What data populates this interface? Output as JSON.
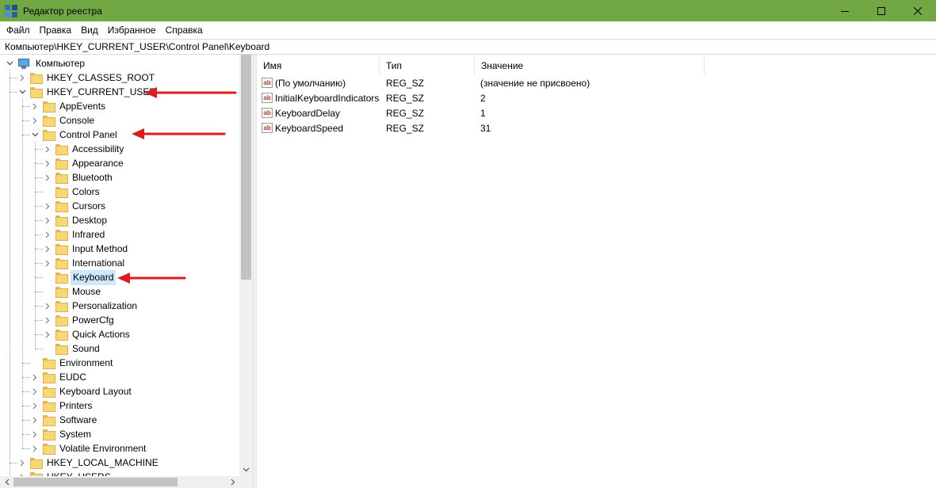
{
  "window": {
    "title": "Редактор реестра",
    "controls": {
      "minimize": "minimize-icon",
      "maximize": "maximize-icon",
      "close": "close-icon"
    }
  },
  "menu": [
    {
      "id": "file",
      "label": "Файл"
    },
    {
      "id": "edit",
      "label": "Правка"
    },
    {
      "id": "view",
      "label": "Вид"
    },
    {
      "id": "favorites",
      "label": "Избранное"
    },
    {
      "id": "help",
      "label": "Справка"
    }
  ],
  "address": "Компьютер\\HKEY_CURRENT_USER\\Control Panel\\Keyboard",
  "tree": [
    {
      "label": "Компьютер",
      "depth": 0,
      "expander": "down",
      "icon": "computer"
    },
    {
      "label": "HKEY_CLASSES_ROOT",
      "depth": 1,
      "expander": "right"
    },
    {
      "label": "HKEY_CURRENT_USER",
      "depth": 1,
      "expander": "down"
    },
    {
      "label": "AppEvents",
      "depth": 2,
      "expander": "right"
    },
    {
      "label": "Console",
      "depth": 2,
      "expander": "right"
    },
    {
      "label": "Control Panel",
      "depth": 2,
      "expander": "down"
    },
    {
      "label": "Accessibility",
      "depth": 3,
      "expander": "right"
    },
    {
      "label": "Appearance",
      "depth": 3,
      "expander": "right"
    },
    {
      "label": "Bluetooth",
      "depth": 3,
      "expander": "right"
    },
    {
      "label": "Colors",
      "depth": 3,
      "expander": "none"
    },
    {
      "label": "Cursors",
      "depth": 3,
      "expander": "right"
    },
    {
      "label": "Desktop",
      "depth": 3,
      "expander": "right"
    },
    {
      "label": "Infrared",
      "depth": 3,
      "expander": "right"
    },
    {
      "label": "Input Method",
      "depth": 3,
      "expander": "right"
    },
    {
      "label": "International",
      "depth": 3,
      "expander": "right"
    },
    {
      "label": "Keyboard",
      "depth": 3,
      "expander": "none",
      "selected": true
    },
    {
      "label": "Mouse",
      "depth": 3,
      "expander": "none"
    },
    {
      "label": "Personalization",
      "depth": 3,
      "expander": "right"
    },
    {
      "label": "PowerCfg",
      "depth": 3,
      "expander": "right"
    },
    {
      "label": "Quick Actions",
      "depth": 3,
      "expander": "right"
    },
    {
      "label": "Sound",
      "depth": 3,
      "expander": "none"
    },
    {
      "label": "Environment",
      "depth": 2,
      "expander": "none"
    },
    {
      "label": "EUDC",
      "depth": 2,
      "expander": "right"
    },
    {
      "label": "Keyboard Layout",
      "depth": 2,
      "expander": "right"
    },
    {
      "label": "Printers",
      "depth": 2,
      "expander": "right"
    },
    {
      "label": "Software",
      "depth": 2,
      "expander": "right"
    },
    {
      "label": "System",
      "depth": 2,
      "expander": "right"
    },
    {
      "label": "Volatile Environment",
      "depth": 2,
      "expander": "right"
    },
    {
      "label": "HKEY_LOCAL_MACHINE",
      "depth": 1,
      "expander": "right"
    },
    {
      "label": "HKEY_USERS",
      "depth": 1,
      "expander": "right"
    }
  ],
  "values": {
    "columns": [
      "Имя",
      "Тип",
      "Значение"
    ],
    "type_icon_text": "ab",
    "rows": [
      {
        "name": "(По умолчанию)",
        "type": "REG_SZ",
        "data": "(значение не присвоено)"
      },
      {
        "name": "InitialKeyboardIndicators",
        "type": "REG_SZ",
        "data": "2"
      },
      {
        "name": "KeyboardDelay",
        "type": "REG_SZ",
        "data": "1"
      },
      {
        "name": "KeyboardSpeed",
        "type": "REG_SZ",
        "data": "31"
      }
    ]
  },
  "annotations": {
    "color": "#e01b1b",
    "targets": [
      "HKEY_CURRENT_USER",
      "Control Panel",
      "Keyboard"
    ]
  },
  "colors": {
    "titlebar": "#72a844",
    "selection": "#cce8ff",
    "folder": "#f8d775"
  }
}
